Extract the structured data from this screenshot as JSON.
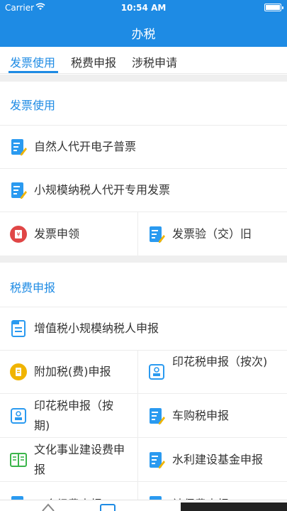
{
  "status_bar": {
    "carrier": "Carrier",
    "time": "10:54 AM"
  },
  "nav": {
    "title": "办税"
  },
  "tabs": [
    {
      "label": "发票使用",
      "active": true
    },
    {
      "label": "税费申报",
      "active": false
    },
    {
      "label": "涉税申请",
      "active": false
    }
  ],
  "sections": {
    "invoice": {
      "title": "发票使用",
      "items": [
        {
          "label": "自然人代开电子普票",
          "icon": "doc-edit-icon"
        },
        {
          "label": "小规模纳税人代开专用发票",
          "icon": "doc-edit-icon"
        },
        {
          "label": "发票申领",
          "icon": "invoice-apply-icon"
        },
        {
          "label": "发票验（交）旧",
          "icon": "doc-edit-icon"
        }
      ]
    },
    "tax": {
      "title": "税费申报",
      "items": [
        {
          "label": "增值税小规模纳税人申报",
          "icon": "vat-doc-icon"
        },
        {
          "label": "附加税(费)申报",
          "icon": "surtax-icon"
        },
        {
          "label": "印花税申报（按次)",
          "icon": "stamp-per-time-icon"
        },
        {
          "label": "印花税申报（按期)",
          "icon": "stamp-per-period-icon"
        },
        {
          "label": "车购税申报",
          "icon": "doc-edit-icon"
        },
        {
          "label": "文化事业建设费申报",
          "icon": "book-icon"
        },
        {
          "label": "水利建设基金申报",
          "icon": "doc-edit-icon"
        },
        {
          "label": "工会经费申报",
          "icon": "doc-edit-icon"
        },
        {
          "label": "社保费申报",
          "icon": "doc-edit-icon"
        }
      ]
    }
  },
  "colors": {
    "primary": "#1e8be4",
    "divider": "#ececec",
    "gap": "#efefef"
  }
}
